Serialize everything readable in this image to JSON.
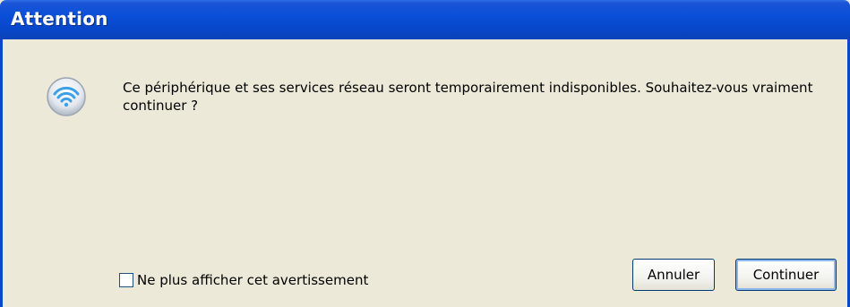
{
  "window": {
    "title": "Attention"
  },
  "dialog": {
    "icon": "wifi-icon",
    "message": "Ce périphérique et ses services réseau seront temporairement indisponibles. Souhaitez-vous vraiment continuer ?",
    "checkbox": {
      "label": "Ne plus afficher cet avertissement",
      "checked": false
    },
    "buttons": {
      "cancel": "Annuler",
      "continue": "Continuer"
    }
  },
  "colors": {
    "titlebar": "#0a4fd8",
    "background": "#ece9d8",
    "title_text": "#ffffff"
  }
}
